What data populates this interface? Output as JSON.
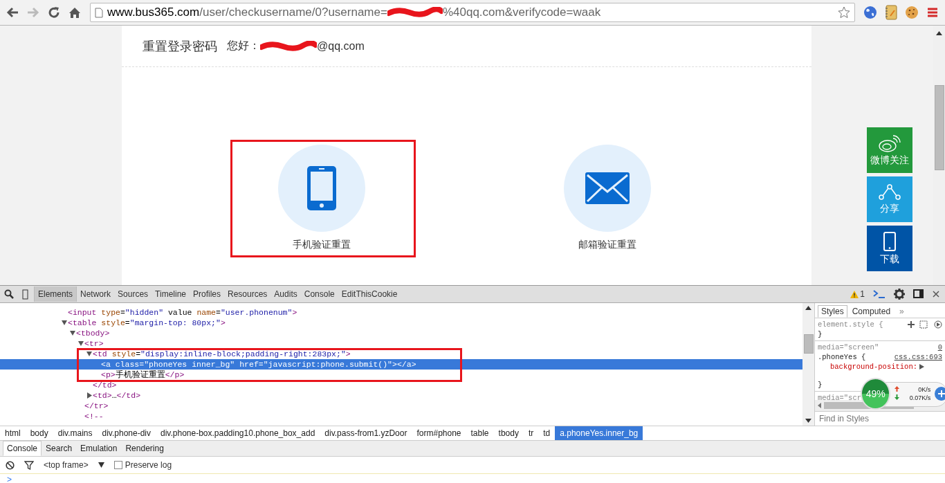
{
  "browser": {
    "forward_disabled": true,
    "url_host": "www.bus365.com",
    "url_path": "/user/checkusername/0?username=",
    "url_tail": "%40qq.com&verifycode=waak"
  },
  "page": {
    "title": "重置登录密码",
    "greeting": "您好：",
    "email_tail": "@qq.com",
    "options": [
      {
        "kind": "phone",
        "label": "手机验证重置"
      },
      {
        "kind": "mail",
        "label": "邮箱验证重置"
      }
    ],
    "side_buttons": [
      {
        "kind": "weibo",
        "label": "微博关注",
        "color": "#23993c"
      },
      {
        "kind": "share",
        "label": "分享",
        "color": "#1fa0dc"
      },
      {
        "kind": "download",
        "label": "下载",
        "color": "#0054a6"
      }
    ]
  },
  "devtools": {
    "tabs": [
      {
        "label": "Elements",
        "selected": true
      },
      {
        "label": "Network",
        "selected": false
      },
      {
        "label": "Sources",
        "selected": false
      },
      {
        "label": "Timeline",
        "selected": false
      },
      {
        "label": "Profiles",
        "selected": false
      },
      {
        "label": "Resources",
        "selected": false
      },
      {
        "label": "Audits",
        "selected": false
      },
      {
        "label": "Console",
        "selected": false
      },
      {
        "label": "EditThisCookie",
        "selected": false
      }
    ],
    "warnings": "1",
    "dom_tree": [
      {
        "text": "<input type=\"hidden\" value name=\"user.phonenum\">",
        "selected": false
      },
      {
        "text": "<table style=\"margin-top: 80px;\">",
        "selected": false,
        "expanded": true,
        "children": [
          {
            "text": "<tbody>",
            "selected": false,
            "expanded": true,
            "children": [
              {
                "text": "<tr>",
                "selected": false,
                "expanded": true,
                "close": "</tr>",
                "children": [
                  {
                    "text": "<td style=\"display:inline-block;padding-right:283px;\">",
                    "selected": false,
                    "expanded": true,
                    "close": "</td>",
                    "children": [
                      {
                        "text": "<a class=\"phoneYes inner_bg\" href=\"javascript:phone.submit()\"></a>",
                        "selected": true
                      },
                      {
                        "text": "<p>手机验证重置</p>",
                        "selected": false
                      }
                    ]
                  },
                  {
                    "text": "<td>…</td>",
                    "selected": false,
                    "expanded": false
                  }
                ]
              },
              {
                "text": "<!--",
                "selected": false
              }
            ]
          }
        ]
      }
    ],
    "styles_tabs": [
      {
        "label": "Styles",
        "selected": true
      },
      {
        "label": "Computed",
        "selected": false
      }
    ],
    "styles_more": "»",
    "styles_rules": [
      {
        "kind": "inline",
        "selector": "element.style {",
        "close": "}"
      },
      {
        "kind": "rule",
        "media": "media=\"screen\"",
        "media_link": "0",
        "selector": ".phoneYes {",
        "source": "css.css:693",
        "property": "background-position:",
        "close": "}"
      },
      {
        "kind": "cut",
        "media": "media=\"scr"
      }
    ],
    "styles_filter_placeholder": "Find in Styles",
    "breadcrumbs": [
      {
        "label": "html",
        "selected": false
      },
      {
        "label": "body",
        "selected": false
      },
      {
        "label": "div.mains",
        "selected": false
      },
      {
        "label": "div.phone-div",
        "selected": false
      },
      {
        "label": "div.phone-box.padding10.phone_box_add",
        "selected": false
      },
      {
        "label": "div.pass-from1.yzDoor",
        "selected": false
      },
      {
        "label": "form#phone",
        "selected": false
      },
      {
        "label": "table",
        "selected": false
      },
      {
        "label": "tbody",
        "selected": false
      },
      {
        "label": "tr",
        "selected": false
      },
      {
        "label": "td",
        "selected": false
      },
      {
        "label": "a.phoneYes.inner_bg",
        "selected": true
      }
    ],
    "drawer_tabs": [
      {
        "label": "Console",
        "selected": true
      },
      {
        "label": "Search",
        "selected": false
      },
      {
        "label": "Emulation",
        "selected": false
      },
      {
        "label": "Rendering",
        "selected": false
      }
    ],
    "console": {
      "context": "<top frame>",
      "preserve_log": false,
      "preserve_label": "Preserve log",
      "prompt": ">"
    }
  },
  "net_widget": {
    "percent": "49%",
    "up": "0K/s",
    "down": "0.07K/s"
  }
}
